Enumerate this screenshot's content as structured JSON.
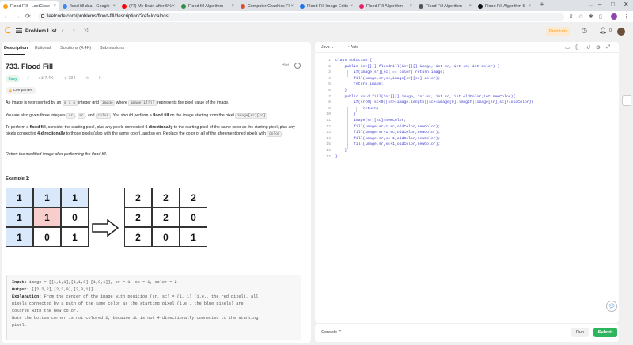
{
  "browser": {
    "tabs": [
      {
        "title": "Flood Fill - LeetCode",
        "color": "#ffa116"
      },
      {
        "title": "flood fill dsa - Google",
        "color": "#4285f4"
      },
      {
        "title": "(77) My Brain after 5%",
        "color": "#ff0000"
      },
      {
        "title": "Flood fill Algorithm -",
        "color": "#2f8d46"
      },
      {
        "title": "Computer Graphics Fl",
        "color": "#e34c26"
      },
      {
        "title": "Flood Fill Image Edito",
        "color": "#1a73e8"
      },
      {
        "title": "Flood Fill Algorithm",
        "color": "#e91e63"
      },
      {
        "title": "Flood Fill Algorithm",
        "color": "#555555"
      },
      {
        "title": "Flood Fill Algorithm S",
        "color": "#111111"
      }
    ],
    "url": "leetcode.com/problems/flood-fill/description/?ref=localhost"
  },
  "nav": {
    "problem_list": "Problem List",
    "premium": "Premium",
    "notif_count": "0"
  },
  "left_tabs": [
    "Description",
    "Editorial",
    "Solutions (4.4K)",
    "Submissions"
  ],
  "problem": {
    "title": "733. Flood Fill",
    "hint": "Hint",
    "difficulty": "Easy",
    "likes": "7.4K",
    "dislikes": "734",
    "companies": "Companies",
    "p1_a": "An image is represented by an ",
    "p1_code1": "m x n",
    "p1_b": " integer grid ",
    "p1_code2": "image",
    "p1_c": " where ",
    "p1_code3": "image[i][j]",
    "p1_d": " represents the pixel value of the image.",
    "p2_a": "You are also given three integers ",
    "p2_code1": "sr",
    "p2_b": ", ",
    "p2_code2": "sc",
    "p2_c": ", and ",
    "p2_code3": "color",
    "p2_d": ". You should perform a ",
    "p2_bold": "flood fill",
    "p2_e": " on the image starting from the pixel ",
    "p2_code4": "image[sr][sc]",
    "p2_f": ".",
    "p3_a": "To perform a ",
    "p3_bold1": "flood fill",
    "p3_b": ", consider the starting pixel, plus any pixels connected ",
    "p3_bold2": "4-directionally",
    "p3_c": " to the starting pixel of the same color as the starting pixel, plus any pixels connected ",
    "p3_bold3": "4-directionally",
    "p3_d": " to those pixels (also with the same color), and so on. Replace the color of all of the aforementioned pixels with ",
    "p3_code": "color",
    "p3_e": ".",
    "p4": "Return the modified image after performing the flood fill.",
    "example_title": "Example 1:",
    "grid_before": [
      [
        "1",
        "1",
        "1"
      ],
      [
        "1",
        "1",
        "0"
      ],
      [
        "1",
        "0",
        "1"
      ]
    ],
    "grid_after": [
      [
        "2",
        "2",
        "2"
      ],
      [
        "2",
        "2",
        "0"
      ],
      [
        "2",
        "0",
        "1"
      ]
    ],
    "input_label": "Input:",
    "input_value": " image = [[1,1,1],[1,1,0],[1,0,1]], sr = 1, sc = 1, color = 2",
    "output_label": "Output:",
    "output_value": " [[2,2,2],[2,2,0],[2,0,1]]",
    "explanation_label": "Explanation:",
    "explanation_1": " From the center of the image with position (sr, sc) = (1, 1) (i.e., the red pixel), all",
    "explanation_2": "pixels connected by a path of the same color as the starting pixel (i.e., the blue pixels) are",
    "explanation_3": "colored with the new color.",
    "explanation_4": "Note the bottom corner is not colored 2, because it is not 4-directionally connected to the starting",
    "explanation_5": "pixel."
  },
  "colors": {
    "blue_cell": "#dae8fc",
    "red_cell": "#f8cecc",
    "white_cell": "#ffffff"
  },
  "editor": {
    "language": "Java",
    "auto": "Auto",
    "lines": [
      "class Solution {",
      "    public int[][] floodFill(int[][] image, int sr, int sc, int color) {",
      "        if(image[sr][sc] == color) return image;",
      "        fill(image,sr,sc,image[sr][sc],color);",
      "        return image;",
      "    }",
      "    public void fill(int[][] image, int sr, int sc, int oldColor,int newColor){",
      "        if(sr<0||sc<0||sr>=image.length||sc>=image[0].length||image[sr][sc]!=oldColor){",
      "            return;",
      "        }",
      "        image[sr][sc]=newColor;",
      "        fill(image,sr-1,sc,oldColor,newColor);",
      "        fill(image,sr+1,sc,oldColor,newColor);",
      "        fill(image,sr,sc-1,oldColor,newColor);",
      "        fill(image,sr,sc+1,oldColor,newColor);",
      "    }",
      "}"
    ],
    "console": "Console",
    "run": "Run",
    "submit": "Submit"
  }
}
